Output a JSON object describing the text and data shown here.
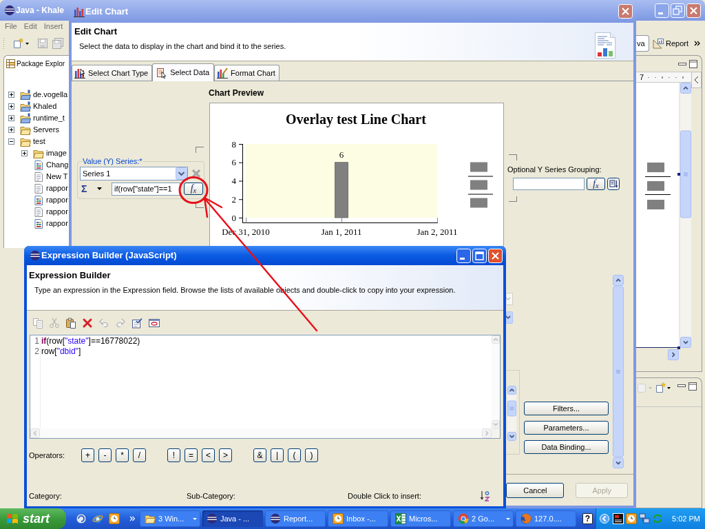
{
  "ide_window": {
    "title": "Java - Khale",
    "menu": [
      "File",
      "Edit",
      "Insert"
    ],
    "perspectives": [
      {
        "label": "va",
        "selected": true
      },
      {
        "label": "Report",
        "selected": false
      }
    ],
    "package_explorer": {
      "tab": "Package Explor",
      "tree": [
        {
          "label": "de.vogella",
          "kind": "project",
          "expanded": false
        },
        {
          "label": "Khaled",
          "kind": "project",
          "expanded": false
        },
        {
          "label": "runtime_t",
          "kind": "project",
          "expanded": false
        },
        {
          "label": "Servers",
          "kind": "folder",
          "expanded": false
        },
        {
          "label": "test",
          "kind": "folder",
          "expanded": true,
          "children": [
            {
              "label": "image",
              "kind": "folder",
              "expanded": false
            },
            {
              "label": "Chang",
              "kind": "report"
            },
            {
              "label": "New T",
              "kind": "document"
            },
            {
              "label": "rappor",
              "kind": "document"
            },
            {
              "label": "rappor",
              "kind": "report"
            },
            {
              "label": "rappor",
              "kind": "document"
            },
            {
              "label": "rappor",
              "kind": "report"
            }
          ]
        }
      ]
    },
    "ruler": "7"
  },
  "edit_chart": {
    "title": "Edit Chart",
    "heading": "Edit Chart",
    "description": "Select the data to display in the chart and bind it to the series.",
    "tabs": [
      {
        "label": "Select Chart Type",
        "kind": "type",
        "selected": false
      },
      {
        "label": "Select Data",
        "kind": "data",
        "selected": true
      },
      {
        "label": "Format Chart",
        "kind": "format",
        "selected": false
      }
    ],
    "preview_label": "Chart Preview",
    "chart_data": {
      "type": "bar",
      "title": "Overlay test Line Chart",
      "categories": [
        "Dec 31, 2010",
        "Jan 1, 2011",
        "Jan 2, 2011"
      ],
      "series": [
        {
          "color": "#808080",
          "values": [
            null,
            6,
            null
          ]
        }
      ],
      "ylim": [
        0,
        8
      ],
      "yticks": [
        0,
        2,
        4,
        6,
        8
      ],
      "data_labels": true
    },
    "value_series": {
      "label": "Value (Y) Series:*",
      "series": "Series 1",
      "aggregate": "Σ",
      "expression": "if(row[\"state\"]==1",
      "builder_button": "f$_{x}$"
    },
    "grouping": {
      "label": "Optional Y Series Grouping:",
      "builder_button": "f$_{x}$"
    },
    "side_buttons": [
      "Filters...",
      "Parameters...",
      "Data Binding..."
    ],
    "buttons": [
      {
        "label": "Cancel",
        "disabled": false
      },
      {
        "label": "Apply",
        "disabled": true
      }
    ]
  },
  "expression_builder": {
    "title": "Expression Builder (JavaScript)",
    "heading": "Expression Builder",
    "description": "Type an expression in the Expression field. Browse the lists of available objects and double-click to copy into your expression.",
    "toolbar": [
      {
        "kind": "copy",
        "disabled": true
      },
      {
        "kind": "cut",
        "disabled": true
      },
      {
        "kind": "paste",
        "disabled": false
      },
      {
        "kind": "delete",
        "disabled": false
      },
      {
        "kind": "undo",
        "disabled": true
      },
      {
        "kind": "redo",
        "disabled": true
      },
      {
        "kind": "validate",
        "disabled": false
      },
      {
        "kind": "window",
        "disabled": false
      }
    ],
    "lines": [
      {
        "number": "1",
        "tokens": [
          {
            "kind": "keyword",
            "text": "if"
          },
          {
            "kind": "plain",
            "text": "(row["
          },
          {
            "kind": "string",
            "text": "\"state\""
          },
          {
            "kind": "plain",
            "text": "]==16778022)"
          }
        ]
      },
      {
        "number": "2",
        "tokens": [
          {
            "kind": "plain",
            "text": "row["
          },
          {
            "kind": "string",
            "text": "\"dbid\""
          },
          {
            "kind": "plain",
            "text": "]"
          }
        ]
      }
    ],
    "operators_label": "Operators:",
    "operator_groups": [
      [
        "+",
        "-",
        "*",
        "/"
      ],
      [
        "!",
        "=",
        "<",
        ">"
      ],
      [
        "&",
        "|",
        "(",
        ")"
      ]
    ],
    "list_labels": [
      "Category:",
      "Sub-Category:",
      "Double Click to insert:"
    ]
  },
  "taskbar": {
    "start": "start",
    "tasks": [
      {
        "label": "3 Win...",
        "kind": "folder",
        "grouped": true,
        "selected": false
      },
      {
        "label": "Java - ...",
        "kind": "sphere",
        "grouped": false,
        "selected": true
      },
      {
        "label": "Report...",
        "kind": "sphere",
        "grouped": false,
        "selected": false
      },
      {
        "label": "Inbox -...",
        "kind": "clock",
        "grouped": false,
        "selected": false
      },
      {
        "label": "Micros...",
        "kind": "sheet",
        "grouped": false,
        "selected": false
      },
      {
        "label": "2 Go...",
        "kind": "wheel",
        "grouped": true,
        "selected": false
      },
      {
        "label": "127.0....",
        "kind": "globe",
        "grouped": false,
        "selected": false
      }
    ],
    "help": "?",
    "clock": "5:02 PM"
  }
}
